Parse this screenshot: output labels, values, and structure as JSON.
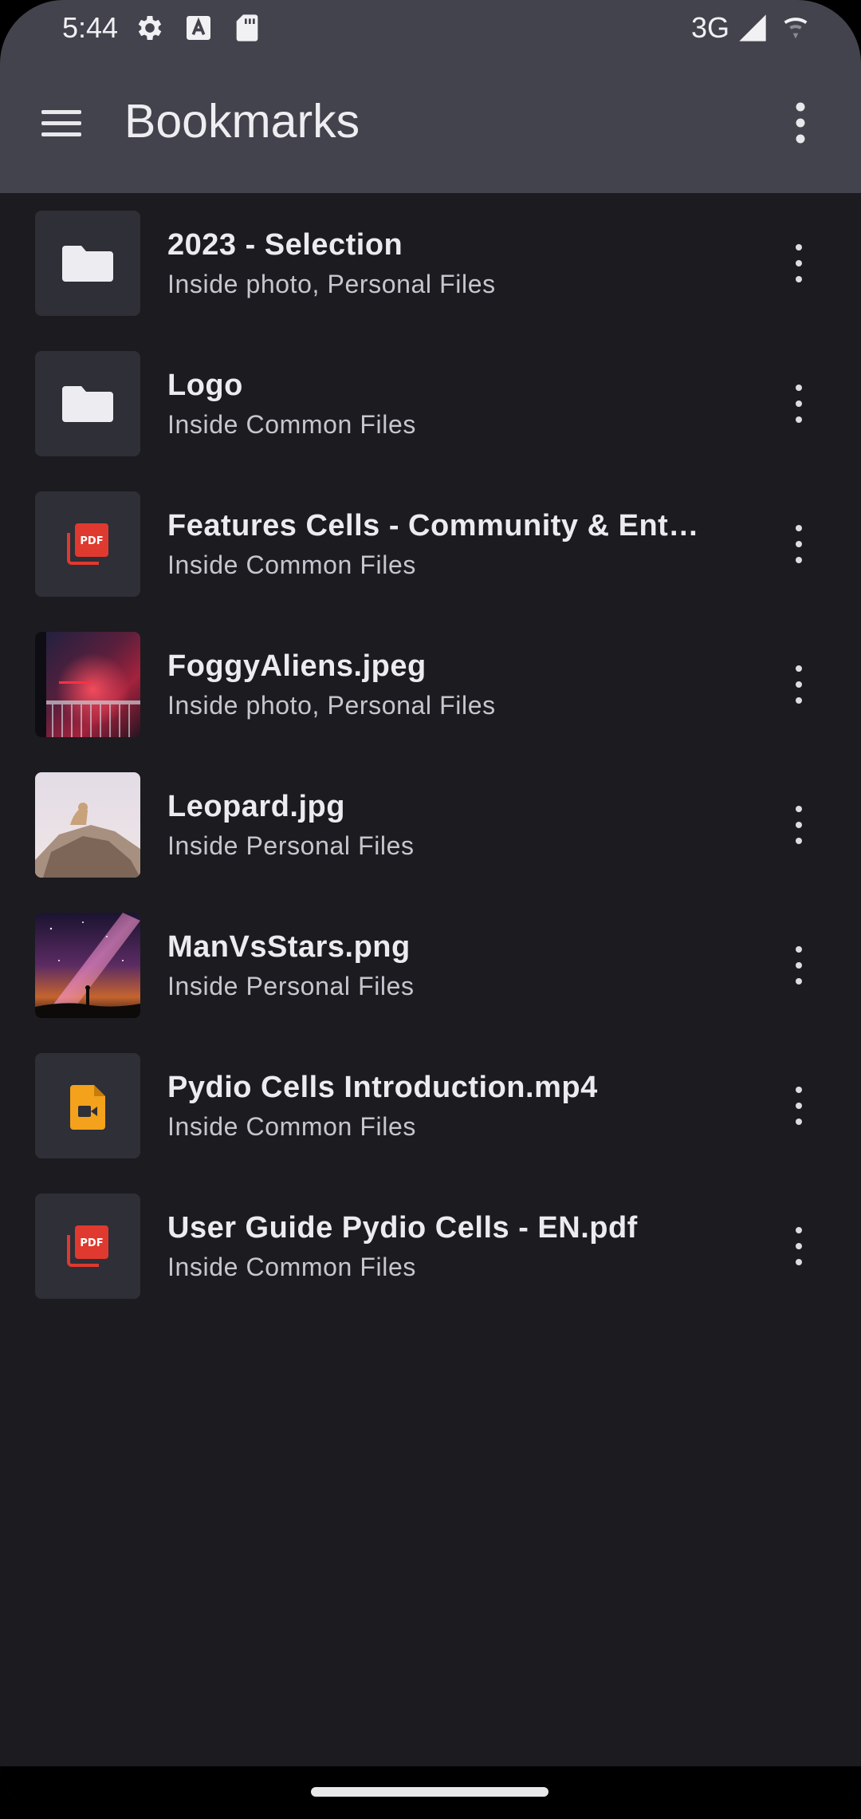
{
  "status_bar": {
    "time": "5:44",
    "network": "3G",
    "icons": [
      "settings-icon",
      "text-a-icon",
      "sd-card-icon",
      "signal-icon",
      "wifi-icon"
    ]
  },
  "app_bar": {
    "title": "Bookmarks",
    "menu_icon": "hamburger-menu-icon",
    "more_icon": "more-vertical-icon"
  },
  "bookmarks": [
    {
      "name": "2023 - Selection",
      "location": "Inside photo, Personal Files",
      "type": "folder",
      "icon": "folder-icon"
    },
    {
      "name": "Logo",
      "location": "Inside Common Files",
      "type": "folder",
      "icon": "folder-icon"
    },
    {
      "name": "Features Cells - Community & Enter…",
      "location": "Inside Common Files",
      "type": "pdf",
      "icon": "pdf-icon"
    },
    {
      "name": "FoggyAliens.jpeg",
      "location": "Inside photo, Personal Files",
      "type": "image",
      "icon": "image-thumbnail"
    },
    {
      "name": "Leopard.jpg",
      "location": "Inside Personal Files",
      "type": "image",
      "icon": "image-thumbnail"
    },
    {
      "name": "ManVsStars.png",
      "location": "Inside Personal Files",
      "type": "image",
      "icon": "image-thumbnail"
    },
    {
      "name": "Pydio Cells Introduction.mp4",
      "location": "Inside Common Files",
      "type": "video",
      "icon": "video-file-icon"
    },
    {
      "name": "User Guide Pydio Cells - EN.pdf",
      "location": "Inside Common Files",
      "type": "pdf",
      "icon": "pdf-icon"
    }
  ],
  "colors": {
    "background": "#1c1b20",
    "app_bar": "#43434d",
    "tile": "#2e2f37",
    "pdf_red": "#e0392f",
    "video_orange": "#f4a11b"
  }
}
